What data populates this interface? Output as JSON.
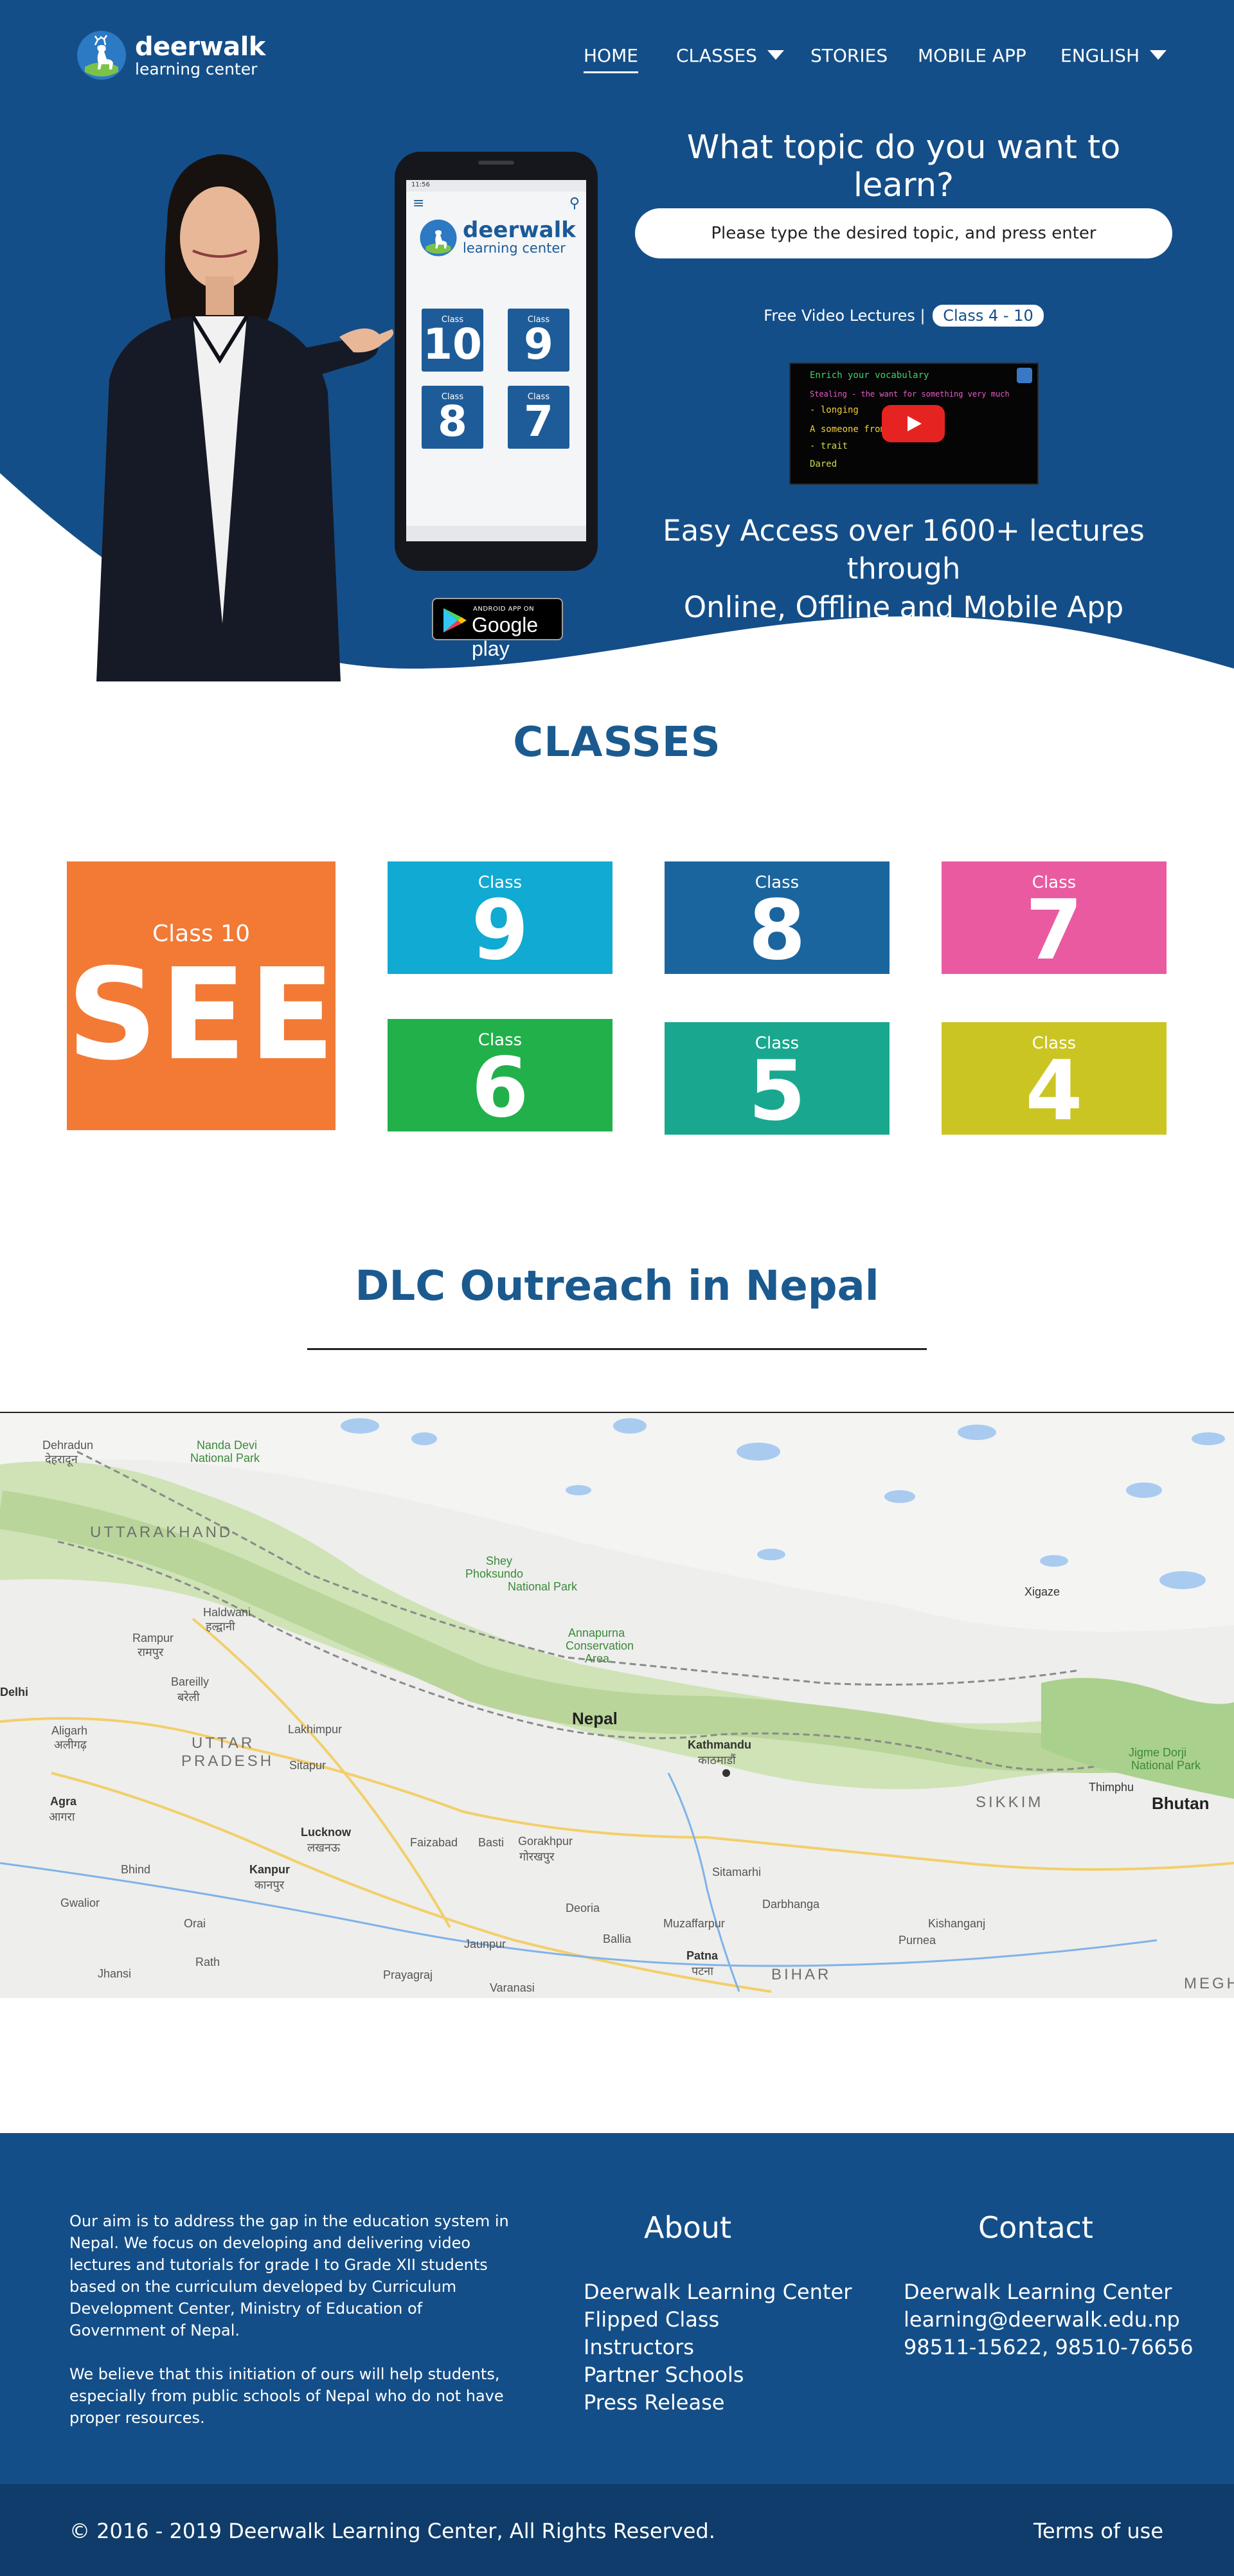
{
  "brand": {
    "name": "deerwalk",
    "subtitle": "learning center"
  },
  "nav": {
    "items": [
      {
        "label": "HOME",
        "active": true
      },
      {
        "label": "CLASSES",
        "dropdown": true
      },
      {
        "label": "STORIES"
      },
      {
        "label": "MOBILE APP"
      },
      {
        "label": "ENGLISH",
        "dropdown": true
      }
    ]
  },
  "hero": {
    "question": "What topic do you want to learn?",
    "search_placeholder": "Please type the desired topic, and press enter",
    "video_caption": "Free Video Lectures |",
    "video_badge": "Class 4 - 10",
    "video_lines": [
      "Enrich your vocabulary",
      "Stealing - the want for something very much",
      "- longing",
      "A someone from who",
      "- trait",
      "Dared"
    ],
    "tagline_line1": "Easy Access over 1600+ lectures through",
    "tagline_line2": "Online, Offline and Mobile App",
    "store_badge_small": "ANDROID APP ON",
    "store_badge_big": "Google play"
  },
  "phone": {
    "status": "11:56",
    "brand_name": "deerwalk",
    "brand_sub": "learning center",
    "tile_label": "Class",
    "tiles": [
      "10",
      "9",
      "8",
      "7"
    ]
  },
  "classes": {
    "title": "CLASSES",
    "label": "Class",
    "see_label": "Class 10",
    "see_text": "SEE",
    "tiles": [
      {
        "num": "9",
        "color": "#10aad2"
      },
      {
        "num": "8",
        "color": "#1b659f"
      },
      {
        "num": "7",
        "color": "#ea5aa1"
      },
      {
        "num": "6",
        "color": "#22b04b"
      },
      {
        "num": "5",
        "color": "#19a88f"
      },
      {
        "num": "4",
        "color": "#cbc523"
      }
    ],
    "see_color": "#f27a35"
  },
  "outreach": {
    "title": "DLC Outreach in Nepal"
  },
  "map": {
    "labels": {
      "nepal": "Nepal",
      "kathmandu": "Kathmandu",
      "kathmandu_np": "काठमाडौं",
      "bhutan": "Bhutan",
      "sikkim": "SIKKIM",
      "bihar": "BIHAR",
      "uttarakhand": "UTTARAKHAND",
      "uttar": "UTTAR",
      "pradesh": "PRADESH",
      "lucknow": "Lucknow",
      "lucknow_hi": "लखनऊ",
      "kanpur": "Kanpur",
      "kanpur_hi": "कानपुर",
      "patna": "Patna",
      "patna_hi": "पटना",
      "gorakhpur": "Gorakhpur",
      "gorakhpur_hi": "गोरखपुर",
      "agra": "Agra",
      "agra_hi": "आगरा",
      "aligarh": "Aligarh",
      "aligarh_hi": "अलीगढ़",
      "bareilly": "Bareilly",
      "bareilly_hi": "बरेली",
      "rampur": "Rampur",
      "rampur_hi": "रामपुर",
      "haldwani": "Haldwani",
      "haldwani_hi": "हल्द्वानी",
      "dehradun": "Dehradun",
      "dehradun_hi": "देहरादून",
      "nanda_devi": "Nanda Devi",
      "nanda_devi2": "National Park",
      "annapurna": "Annapurna",
      "annapurna2": "Conservation",
      "annapurna3": "Area",
      "shey": "Shey",
      "shey2": "Phoksundo",
      "shey3": "National Park",
      "xigaze": "Xigaze",
      "thimphu": "Thimphu",
      "jigme": "Jigme Dorji",
      "jigme2": "National Park",
      "darbhanga": "Darbhanga",
      "muzaffarpur": "Muzaffarpur",
      "sitamarhi": "Sitamarhi",
      "purnea": "Purnea",
      "kishanganj": "Kishanganj",
      "faizabad": "Faizabad",
      "basti": "Basti",
      "deoria": "Deoria",
      "ballia": "Ballia",
      "jaunpur": "Jaunpur",
      "prayagraj": "Prayagraj",
      "varanasi": "Varanasi",
      "jhansi": "Jhansi",
      "gwalior": "Gwalior",
      "orai": "Orai",
      "rath": "Rath",
      "bhind": "Bhind",
      "sitapur": "Sitapur",
      "lakhimpur": "Lakhimpur",
      "delhi": "Delhi",
      "meghalaya": "MEGH"
    }
  },
  "footer": {
    "about_p1": "Our aim is to address the gap in the education system in Nepal. We focus on developing and delivering video lectures and tutorials for grade I to Grade XII students based on the curriculum developed by Curriculum Development Center, Ministry of Education of Government of Nepal.",
    "about_p2": "We believe that this initiation of ours will help students, especially from public schools of Nepal who do not have proper resources.",
    "about_heading": "About",
    "about_links": [
      "Deerwalk Learning Center",
      "Flipped Class",
      "Instructors",
      "Partner Schools",
      "Press Release"
    ],
    "contact_heading": "Contact",
    "contact_name": "Deerwalk Learning Center",
    "contact_email": "learning@deerwalk.edu.np",
    "contact_phone": "98511-15622, 98510-76656",
    "copyright": "© 2016 - 2019 Deerwalk Learning Center, All Rights Reserved.",
    "terms": "Terms of use"
  }
}
